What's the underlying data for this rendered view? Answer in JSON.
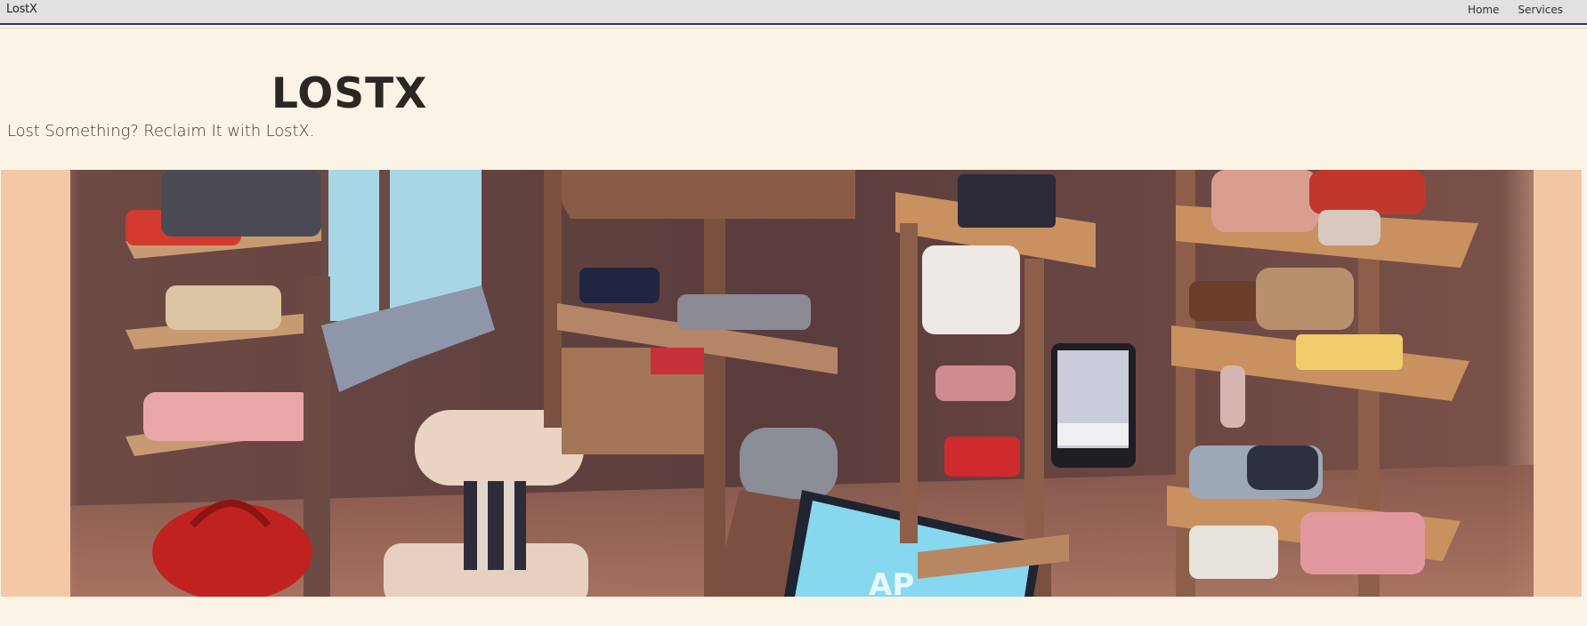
{
  "nav": {
    "brand": "LostX",
    "links": [
      "Home",
      "Services"
    ]
  },
  "header": {
    "title": "LOSTX",
    "tagline": "Lost Something? Reclaim It with LostX."
  },
  "hero": {
    "screen_text": "AP"
  },
  "colors": {
    "page_background": "#fbf3e6",
    "navbar_background": "#e1e1e1",
    "navbar_border": "#2d3566",
    "title_text": "#2a2724"
  }
}
